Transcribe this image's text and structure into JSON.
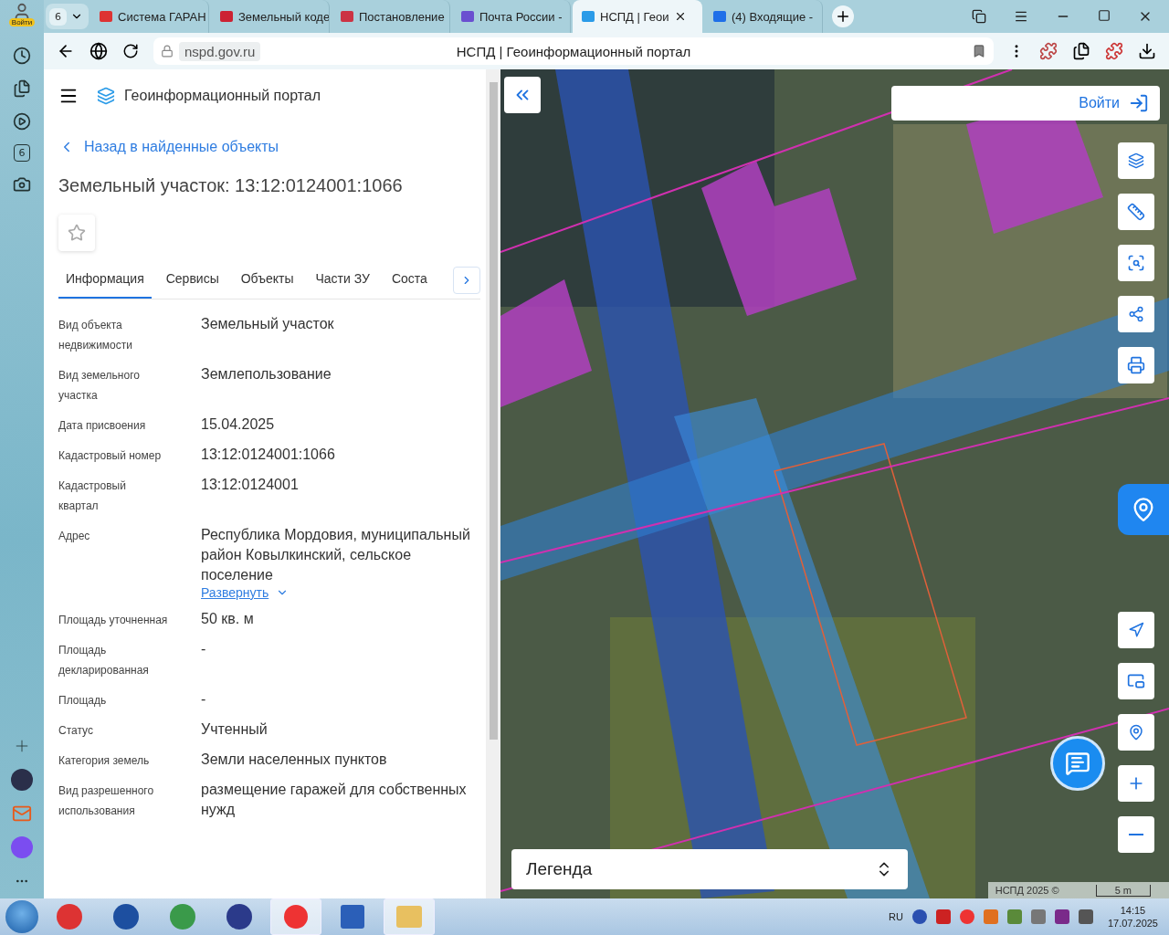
{
  "browser": {
    "profile": "Войти",
    "tab_count": "6",
    "tabs": [
      {
        "title": "Система ГАРАН",
        "selected": false
      },
      {
        "title": "Земельный коде",
        "selected": false
      },
      {
        "title": "Постановление",
        "selected": false
      },
      {
        "title": "Почта России -",
        "selected": false
      },
      {
        "title": "НСПД | Геои",
        "selected": true
      },
      {
        "title": "(4) Входящие -",
        "selected": false
      }
    ],
    "address": "nspd.gov.ru",
    "page_title": "НСПД | Геоинформационный портал"
  },
  "sidebar": {
    "badge": "6"
  },
  "portal": {
    "title": "Геоинформационный портал",
    "back_link": "Назад в найденные объекты",
    "heading": "Земельный участок: 13:12:0124001:1066",
    "tabs": [
      {
        "label": "Информация",
        "selected": true
      },
      {
        "label": "Сервисы",
        "selected": false
      },
      {
        "label": "Объекты",
        "selected": false
      },
      {
        "label": "Части ЗУ",
        "selected": false
      },
      {
        "label": "Соста",
        "selected": false
      }
    ],
    "fields": [
      {
        "label": "Вид объекта недвижимости",
        "value": "Земельный участок"
      },
      {
        "label": "Вид земельного участка",
        "value": "Землепользование"
      },
      {
        "label": "Дата присвоения",
        "value": "15.04.2025"
      },
      {
        "label": "Кадастровый номер",
        "value": "13:12:0124001:1066"
      },
      {
        "label": "Кадастровый квартал",
        "value": "13:12:0124001"
      },
      {
        "label": "Адрес",
        "value": "Республика Мордовия, муниципальный район Ковылкинский, сельское поселение",
        "link": "Развернуть"
      },
      {
        "label": "Площадь уточненная",
        "value": "50 кв. м"
      },
      {
        "label": "Площадь декларированная",
        "value": "-"
      },
      {
        "label": "Площадь",
        "value": "-"
      },
      {
        "label": "Статус",
        "value": "Учтенный"
      },
      {
        "label": "Категория земель",
        "value": "Земли населенных пунктов"
      },
      {
        "label": "Вид разрешенного использования",
        "value": "размещение гаражей для собственных нужд"
      }
    ]
  },
  "map": {
    "login": "Войти",
    "legend": "Легенда",
    "attribution": "НСПД 2025 ©",
    "scale": "5 m"
  },
  "taskbar": {
    "language": "RU",
    "time": "14:15",
    "date": "17.07.2025"
  }
}
